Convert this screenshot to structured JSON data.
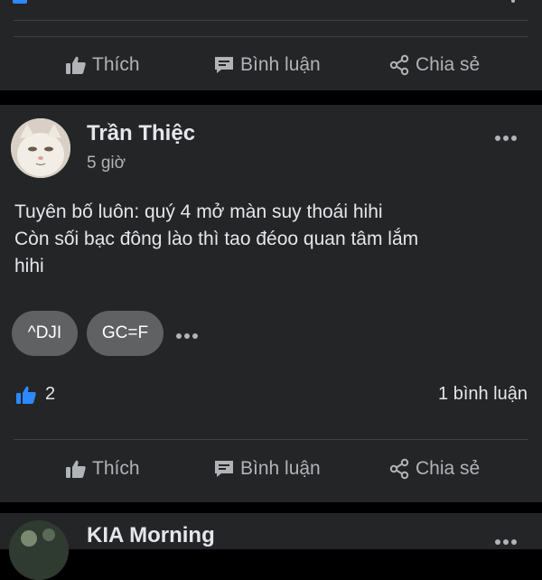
{
  "actions": {
    "like": "Thích",
    "comment": "Bình luận",
    "share": "Chia sẻ"
  },
  "post": {
    "author": "Trần Thiệc",
    "time": "5 giờ",
    "lines": [
      "Tuyên bố luôn: quý 4 mở màn suy thoái hihi",
      "Còn sối bạc đông lào thì tao đéoo quan tâm lắm",
      "hihi"
    ],
    "tags": [
      "^DJI",
      "GC=F"
    ],
    "like_count": "2",
    "comment_count": "1 bình luận"
  },
  "next_post": {
    "author": "KIA Morning"
  },
  "colors": {
    "background": "#000000",
    "card": "#242526",
    "text": "#e4e6eb",
    "muted": "#b0b3b8",
    "accent": "#2d88ff",
    "chip": "#5f6163"
  }
}
